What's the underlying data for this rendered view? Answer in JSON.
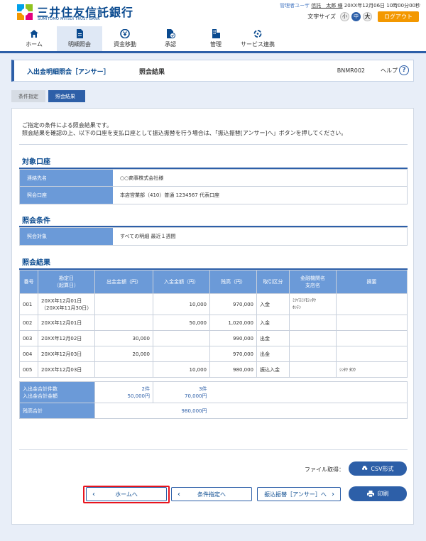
{
  "header": {
    "logo_jp": "三井住友信託銀行",
    "logo_en": "SUMITOMO MITSUI TRUST BANK",
    "user_role": "管理者ユーザ",
    "user_name": "信託　太郎 様",
    "datetime": "20XX年12月06日 10時00分00秒",
    "font_size_label": "文字サイズ",
    "font_small": "小",
    "font_medium": "中",
    "font_large": "大",
    "logout": "ログアウト",
    "colors": {
      "brand": "#0a4a8f",
      "accent": "#2d5fa8",
      "logout": "#f39800"
    }
  },
  "nav": {
    "items": [
      {
        "label": "ホーム",
        "icon": "home-icon"
      },
      {
        "label": "明細照会",
        "icon": "document-icon"
      },
      {
        "label": "資金移動",
        "icon": "money-transfer-icon"
      },
      {
        "label": "承認",
        "icon": "approval-icon"
      },
      {
        "label": "管理",
        "icon": "management-icon"
      },
      {
        "label": "サービス連携",
        "icon": "service-link-icon"
      }
    ],
    "active": "明細照会"
  },
  "title_bar": {
    "title": "入出金明細照会［アンサー］",
    "subtitle": "照会結果",
    "screen_code": "BNMR002",
    "help": "ヘルプ"
  },
  "steps": [
    "条件指定",
    "照会結果"
  ],
  "intro": {
    "line1": "ご指定の条件による照会結果です。",
    "line2": "照会結果を確認の上、以下の口座を支払口座として振込振替を行う場合は、「振込振替[アンサー]へ」ボタンを押してください。"
  },
  "account_section": {
    "title": "対象口座",
    "rows": [
      {
        "key": "連絡先名",
        "value": "○○商事株式会社様"
      },
      {
        "key": "照会口座",
        "value": "本店営業部（410）普通 1234567 代表口座"
      }
    ]
  },
  "condition_section": {
    "title": "照会条件",
    "rows": [
      {
        "key": "照会対象",
        "value": "すべての明細 最近１週間"
      }
    ]
  },
  "results_section": {
    "title": "照会結果",
    "headers": [
      "番号",
      "勘定日\n（起算日）",
      "出金金額（円）",
      "入金金額（円）",
      "残高（円）",
      "取引区分",
      "金融機関名\n支店名",
      "摘要"
    ],
    "rows": [
      {
        "no": "001",
        "date": "20XX年12月01日",
        "date2": "（20XX年11月30日）",
        "withdrawal": "",
        "deposit": "10,000",
        "balance": "970,000",
        "type": "入金",
        "bank": "ﾐﾂｲｽﾐﾄﾓｼﾝﾀｸ",
        "branch": "ﾎﾝﾃﾝ",
        "memo": ""
      },
      {
        "no": "002",
        "date": "20XX年12月01日",
        "date2": "",
        "withdrawal": "",
        "deposit": "50,000",
        "balance": "1,020,000",
        "type": "入金",
        "bank": "",
        "branch": "",
        "memo": ""
      },
      {
        "no": "003",
        "date": "20XX年12月02日",
        "date2": "",
        "withdrawal": "30,000",
        "deposit": "",
        "balance": "990,000",
        "type": "出金",
        "bank": "",
        "branch": "",
        "memo": ""
      },
      {
        "no": "004",
        "date": "20XX年12月03日",
        "date2": "",
        "withdrawal": "20,000",
        "deposit": "",
        "balance": "970,000",
        "type": "出金",
        "bank": "",
        "branch": "",
        "memo": ""
      },
      {
        "no": "005",
        "date": "20XX年12月03日",
        "date2": "",
        "withdrawal": "",
        "deposit": "10,000",
        "balance": "980,000",
        "type": "振込入金",
        "bank": "",
        "branch": "",
        "memo": "ｼﾝﾀｸ ﾀﾛｳ"
      }
    ],
    "summary": {
      "count_label": "入出金合計件数",
      "amount_label": "入出金合計金額",
      "withdrawal_count": "2件",
      "withdrawal_amount": "50,000円",
      "deposit_count": "3件",
      "deposit_amount": "70,000円",
      "balance_label": "残高合計",
      "balance_total": "980,000円"
    }
  },
  "file": {
    "label": "ファイル取得：",
    "csv_button": "CSV形式"
  },
  "buttons": {
    "home": "ホームへ",
    "condition": "条件指定へ",
    "transfer": "振込振替［アンサー］へ",
    "print": "印刷"
  }
}
